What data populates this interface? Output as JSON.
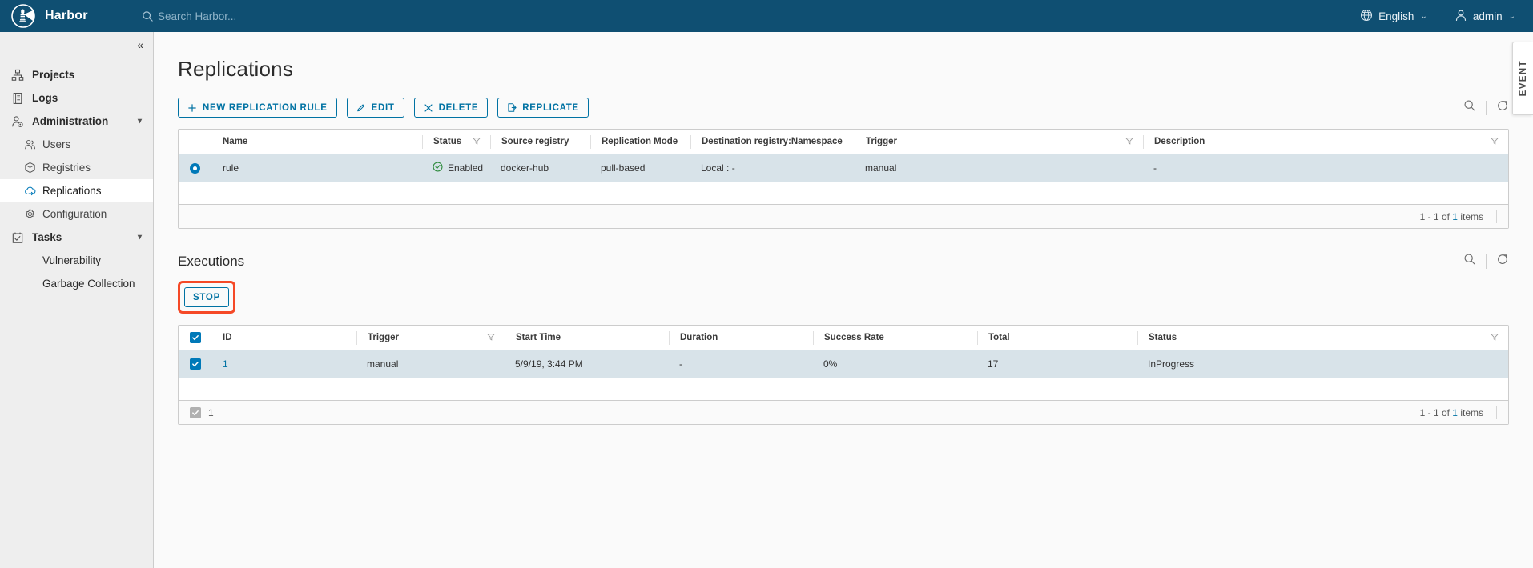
{
  "header": {
    "brand": "Harbor",
    "logo_icon": "harbor-lighthouse-logo",
    "search_icon": "search-icon",
    "search_placeholder": "Search Harbor...",
    "language": "English",
    "language_icon": "globe-icon",
    "user": "admin",
    "user_icon": "user-icon",
    "caret": "⌄"
  },
  "sidebar": {
    "collapse_icon": "«",
    "items": [
      {
        "label": "Projects",
        "icon": "projects-icon",
        "level": "top",
        "active": false,
        "expandable": false
      },
      {
        "label": "Logs",
        "icon": "logs-icon",
        "level": "top",
        "active": false,
        "expandable": false
      },
      {
        "label": "Administration",
        "icon": "administration-icon",
        "level": "top",
        "active": false,
        "expandable": true
      },
      {
        "label": "Users",
        "icon": "users-icon",
        "level": "sub",
        "active": false,
        "expandable": false
      },
      {
        "label": "Registries",
        "icon": "registries-icon",
        "level": "sub",
        "active": false,
        "expandable": false
      },
      {
        "label": "Replications",
        "icon": "replications-icon",
        "level": "sub",
        "active": true,
        "expandable": false
      },
      {
        "label": "Configuration",
        "icon": "configuration-icon",
        "level": "sub",
        "active": false,
        "expandable": false
      },
      {
        "label": "Tasks",
        "icon": "tasks-icon",
        "level": "top",
        "active": false,
        "expandable": true
      },
      {
        "label": "Vulnerability",
        "icon": "",
        "level": "sub-noicon",
        "active": false,
        "expandable": false
      },
      {
        "label": "Garbage Collection",
        "icon": "",
        "level": "sub-noicon",
        "active": false,
        "expandable": false
      }
    ]
  },
  "main": {
    "page_title": "Replications",
    "toolbar": {
      "new_rule_label": "NEW REPLICATION RULE",
      "new_rule_icon": "plus-icon",
      "edit_label": "EDIT",
      "edit_icon": "pencil-icon",
      "delete_label": "DELETE",
      "delete_icon": "close-x-icon",
      "replicate_label": "REPLICATE",
      "replicate_icon": "replicate-icon",
      "search_icon": "search-icon",
      "refresh_icon": "refresh-icon"
    },
    "rules_table": {
      "columns": [
        "Name",
        "Status",
        "Source registry",
        "Replication Mode",
        "Destination registry:Namespace",
        "Trigger",
        "Description"
      ],
      "filterable": [
        false,
        true,
        false,
        false,
        false,
        true,
        true
      ],
      "rows": [
        {
          "selected": true,
          "name": "rule",
          "status": "Enabled",
          "status_icon": "check-circle-icon",
          "source_registry": "docker-hub",
          "replication_mode": "pull-based",
          "destination": "Local : -",
          "trigger": "manual",
          "description": "-"
        }
      ],
      "footer_count_prefix": "1 - 1 of ",
      "footer_count_total": "1",
      "footer_count_suffix": " items"
    },
    "executions": {
      "section_title": "Executions",
      "stop_label": "STOP",
      "highlight_color": "#f54927",
      "search_icon": "search-icon",
      "refresh_icon": "refresh-icon",
      "columns": [
        "ID",
        "Trigger",
        "Start Time",
        "Duration",
        "Success Rate",
        "Total",
        "Status"
      ],
      "filterable": [
        false,
        true,
        false,
        false,
        false,
        false,
        true
      ],
      "rows": [
        {
          "checked": true,
          "id": "1",
          "trigger": "manual",
          "start_time": "5/9/19, 3:44 PM",
          "duration": "-",
          "success_rate": "0%",
          "total": "17",
          "status": "InProgress"
        }
      ],
      "selected_count": "1",
      "footer_count_prefix": "1 - 1 of ",
      "footer_count_total": "1",
      "footer_count_suffix": " items"
    }
  },
  "event_tab": {
    "label": "EVENT"
  }
}
